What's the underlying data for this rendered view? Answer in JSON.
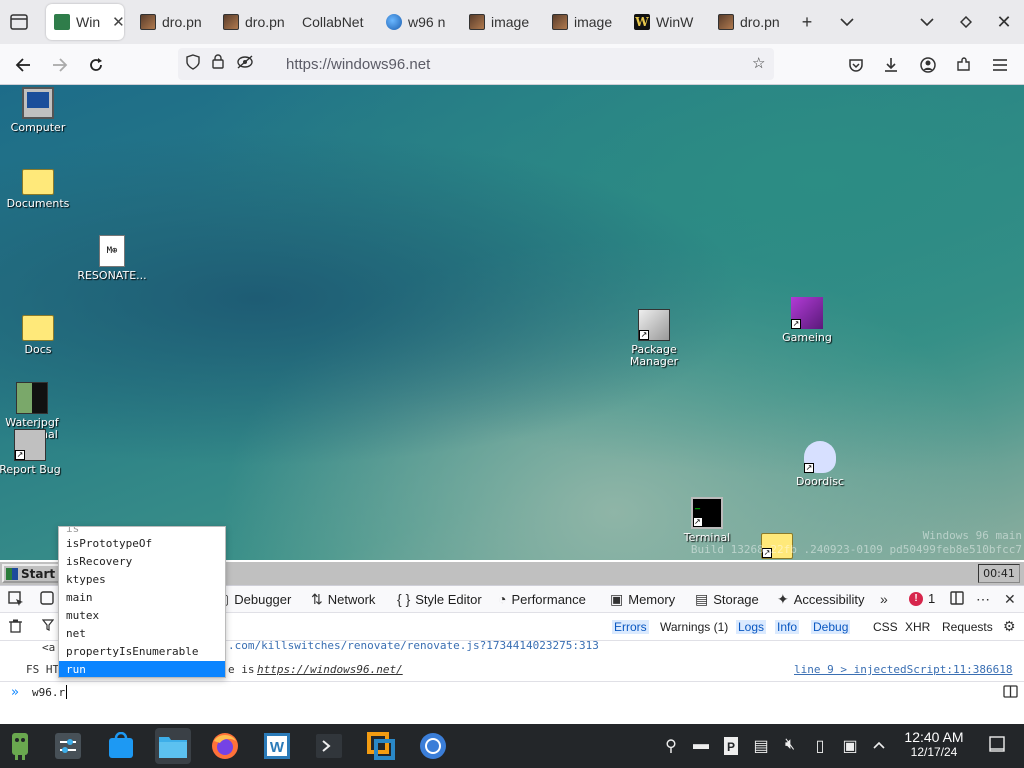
{
  "browser": {
    "tabs": [
      {
        "label": "Win",
        "icon": "windows96-icon",
        "active": true
      },
      {
        "label": "dro.pn",
        "icon": "image-icon"
      },
      {
        "label": "dro.pn",
        "icon": "image-icon"
      },
      {
        "label": "CollabNet",
        "icon": "none"
      },
      {
        "label": "w96 n",
        "icon": "globe-icon"
      },
      {
        "label": "image",
        "icon": "image-icon"
      },
      {
        "label": "image",
        "icon": "image-icon"
      },
      {
        "label": "WinW",
        "icon": "winworld-icon"
      },
      {
        "label": "dro.pn",
        "icon": "image-icon"
      }
    ],
    "url": "https://windows96.net"
  },
  "desktop": {
    "icons": {
      "computer": "Computer",
      "documents": "Documents",
      "resonate": "RESONATE...",
      "resonate_badge": "M⊕",
      "docs": "Docs",
      "waterjpgf": "Waterjpgf",
      "terminal_partial": "inal",
      "report_bug": "Report Bug",
      "package_manager": "Package Manager",
      "gameing": "Gameing",
      "doordisc": "Doordisc",
      "terminal": "Terminal"
    },
    "watermark": {
      "line1": "Windows 96 main",
      "line2": "Build 13268.22fb .240923-0109 pd50499feb8e510bfcc7"
    }
  },
  "w96_taskbar": {
    "start_label": "Start",
    "clock": "00:41"
  },
  "devtools": {
    "tabs": [
      "Debugger",
      "Network",
      "Style Editor",
      "Performance",
      "Memory",
      "Storage",
      "Accessibility"
    ],
    "error_count": "1",
    "filters": {
      "errors": "Errors",
      "warnings": "Warnings (1)",
      "logs": "Logs",
      "info": "Info",
      "debug": "Debug",
      "css": "CSS",
      "xhr": "XHR",
      "requests": "Requests"
    },
    "console": {
      "line1_prefix": "<a",
      "line1_url": ".com/killswitches/renovate/renovate.js?1734414023275:313",
      "line2_prefix": "FS HT",
      "line2_mid": "e is",
      "line2_url": "https://windows96.net/",
      "line2_source": "line 9 > injectedScript:11:386618",
      "input_value": "w96.r"
    },
    "autocomplete": {
      "cut_item": "is",
      "items": [
        "isPrototypeOf",
        "isRecovery",
        "ktypes",
        "main",
        "mutex",
        "net",
        "propertyIsEnumerable",
        "run"
      ],
      "selected": "run"
    }
  },
  "os_panel": {
    "time": "12:40 AM",
    "date": "12/17/24"
  },
  "colors": {
    "accent": "#0a84ff",
    "error": "#d7264c"
  }
}
